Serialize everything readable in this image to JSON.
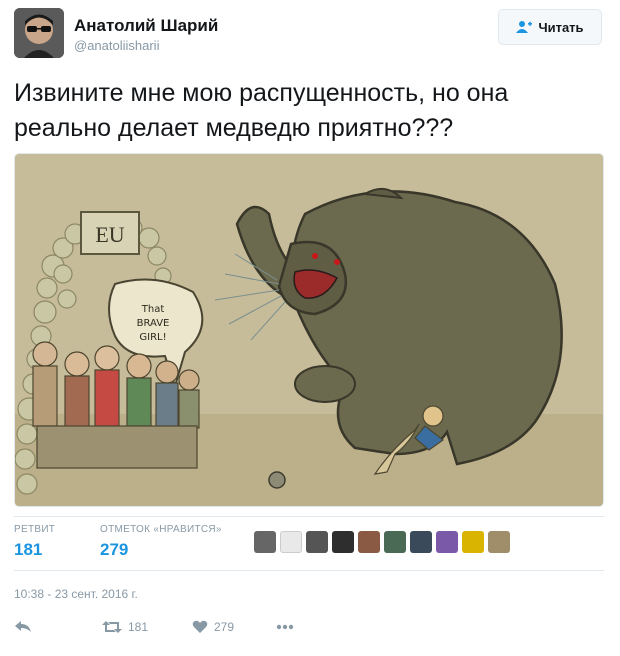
{
  "author": {
    "name": "Анатолий Шарий",
    "handle": "@anatoliisharii"
  },
  "follow_button": {
    "label": "Читать",
    "icon": "add-user-icon"
  },
  "tweet": {
    "line1": "Извините мне мою распущенность, но она",
    "line2": "реально делает медведю приятно???"
  },
  "image_texts": {
    "sign": "EU",
    "bubble_line1": "That",
    "bubble_line2": "BRAVE",
    "bubble_line3": "GIRL!"
  },
  "stats": {
    "retweets_label": "РЕТВИТ",
    "retweets_value": "181",
    "likes_label": "ОТМЕТОК «НРАВИТСЯ»",
    "likes_value": "279"
  },
  "likers_count_shown": 10,
  "timestamp": "10:38 - 23 сент. 2016 г.",
  "actions": {
    "reply_icon": "reply-icon",
    "retweet_icon": "retweet-icon",
    "retweet_count": "181",
    "like_icon": "heart-icon",
    "like_count": "279",
    "more_icon": "more-icon"
  },
  "colors": {
    "link_blue": "#1b95e0",
    "meta_gray": "#8899a6",
    "border": "#e1e8ed"
  }
}
